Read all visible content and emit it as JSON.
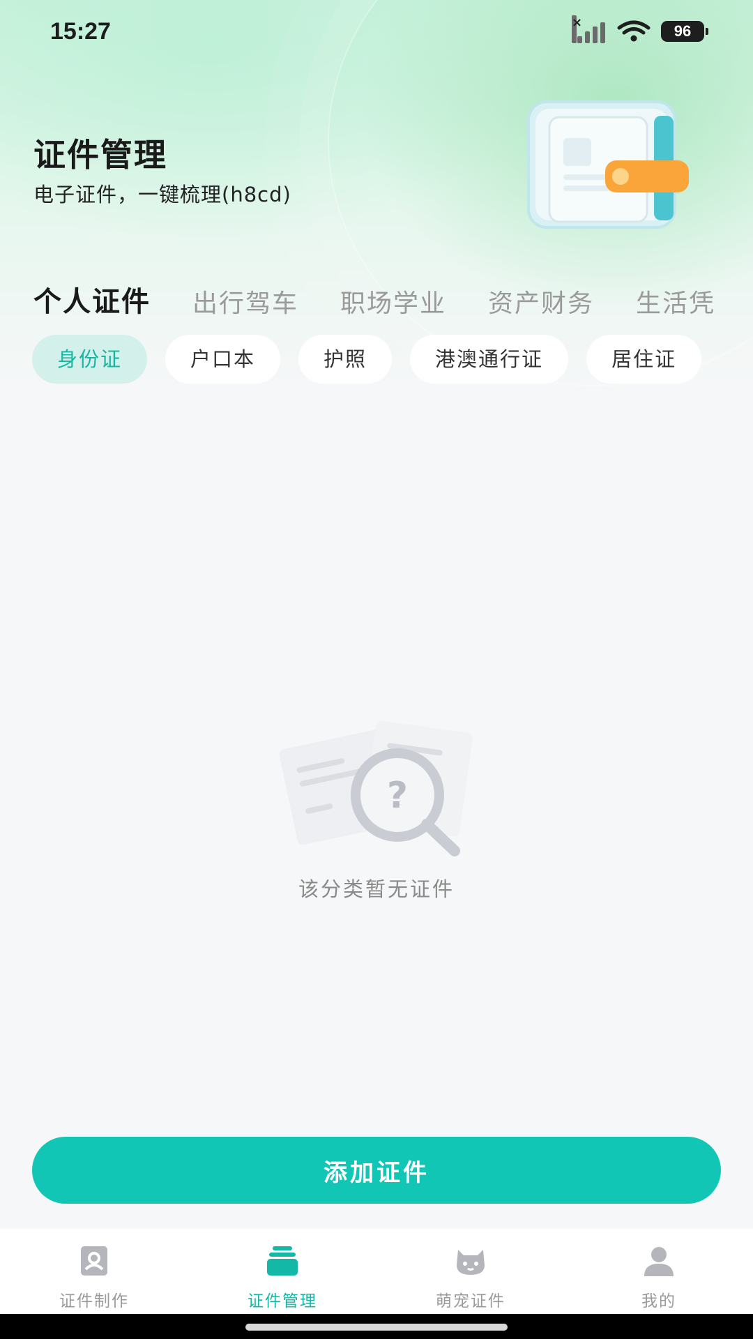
{
  "status_bar": {
    "time": "15:27",
    "battery": "96"
  },
  "header": {
    "title": "证件管理",
    "subtitle": "电子证件，一键梳理(h8cd)"
  },
  "category_tabs": [
    "个人证件",
    "出行驾车",
    "职场学业",
    "资产财务",
    "生活凭"
  ],
  "active_category": "个人证件",
  "doc_chips": [
    "身份证",
    "户口本",
    "护照",
    "港澳通行证",
    "居住证"
  ],
  "active_chip": "身份证",
  "empty_state": {
    "text": "该分类暂无证件",
    "icon": "search-question-icon"
  },
  "add_button": {
    "label": "添加证件"
  },
  "bottom_nav": [
    {
      "label": "证件制作",
      "icon": "id-card-icon"
    },
    {
      "label": "证件管理",
      "icon": "card-stack-icon"
    },
    {
      "label": "萌宠证件",
      "icon": "pet-icon"
    },
    {
      "label": "我的",
      "icon": "user-icon"
    }
  ],
  "active_nav": "证件管理",
  "colors": {
    "accent": "#12c6b6",
    "chip_active_bg": "#d3f1ea",
    "chip_active_text": "#16b6a3",
    "header_green": "#c9f1dc"
  }
}
